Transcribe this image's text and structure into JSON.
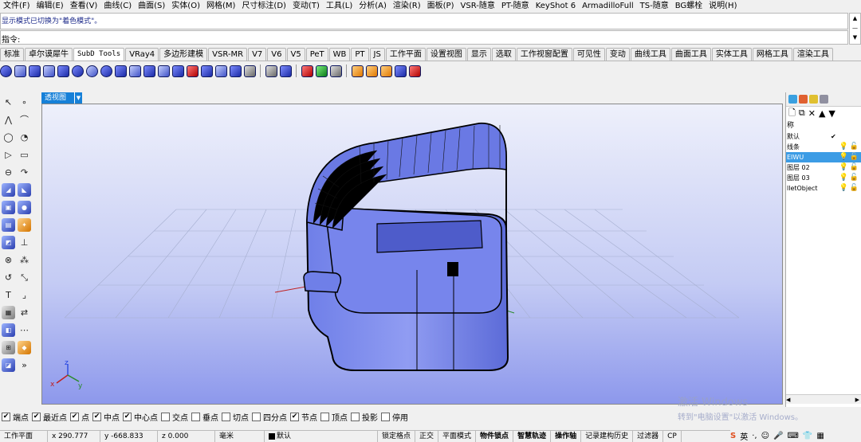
{
  "menu": [
    "文件(F)",
    "编辑(E)",
    "查看(V)",
    "曲线(C)",
    "曲面(S)",
    "实体(O)",
    "网格(M)",
    "尺寸标注(D)",
    "变动(T)",
    "工具(L)",
    "分析(A)",
    "渲染(R)",
    "面板(P)",
    "VSR-随意",
    "PT-随意",
    "KeyShot 6",
    "ArmadilloFull",
    "TS-随意",
    "BG螺栓",
    "说明(H)"
  ],
  "command_history": "显示模式已切换为\"着色模式\"。",
  "command_prompt": "指令:",
  "toolbar_tabs": [
    "标准",
    "卓尔谟犀牛",
    "SubD Tools",
    "VRay4",
    "多边形建模",
    "VSR-MR",
    "V7",
    "V6",
    "V5",
    "PeT",
    "WB",
    "PT",
    "JS",
    "工作平面",
    "设置视图",
    "显示",
    "选取",
    "工作视窗配置",
    "可见性",
    "变动",
    "曲线工具",
    "曲面工具",
    "实体工具",
    "网格工具",
    "渲染工具"
  ],
  "active_tab_index": 2,
  "viewport": {
    "label": "透视图"
  },
  "axes": {
    "z": "z",
    "x": "x",
    "y": "y"
  },
  "layers": {
    "header": "称",
    "items": [
      {
        "name": "默认",
        "check": "✔"
      },
      {
        "name": "线条"
      },
      {
        "name": "EIWU"
      },
      {
        "name": "图层 02"
      },
      {
        "name": "图层 03"
      },
      {
        "name": "lletObject"
      }
    ],
    "selected_index": 2
  },
  "osnaps": [
    {
      "label": "端点",
      "checked": true
    },
    {
      "label": "最近点",
      "checked": true
    },
    {
      "label": "点",
      "checked": true
    },
    {
      "label": "中点",
      "checked": true
    },
    {
      "label": "中心点",
      "checked": true
    },
    {
      "label": "交点",
      "checked": false
    },
    {
      "label": "垂点",
      "checked": false
    },
    {
      "label": "切点",
      "checked": false
    },
    {
      "label": "四分点",
      "checked": false
    },
    {
      "label": "节点",
      "checked": true
    },
    {
      "label": "顶点",
      "checked": false
    },
    {
      "label": "投影",
      "checked": false
    },
    {
      "label": "停用",
      "checked": false
    }
  ],
  "status": {
    "cplane": "工作平面",
    "x": "x 290.777",
    "y": "y -668.833",
    "z": "z 0.000",
    "units": "毫米",
    "layer": "默认",
    "toggles": [
      "锁定格点",
      "正交",
      "平面模式",
      "物件锁点",
      "智慧轨迹",
      "操作轴",
      "记录建构历史",
      "过滤器",
      "CP"
    ],
    "bold_toggles": [
      3,
      4,
      5
    ]
  },
  "watermark": {
    "line1": "激活 Windows",
    "line2": "转到\"电脑设置\"以激活 Windows。"
  },
  "tray": {
    "ime": "英"
  }
}
